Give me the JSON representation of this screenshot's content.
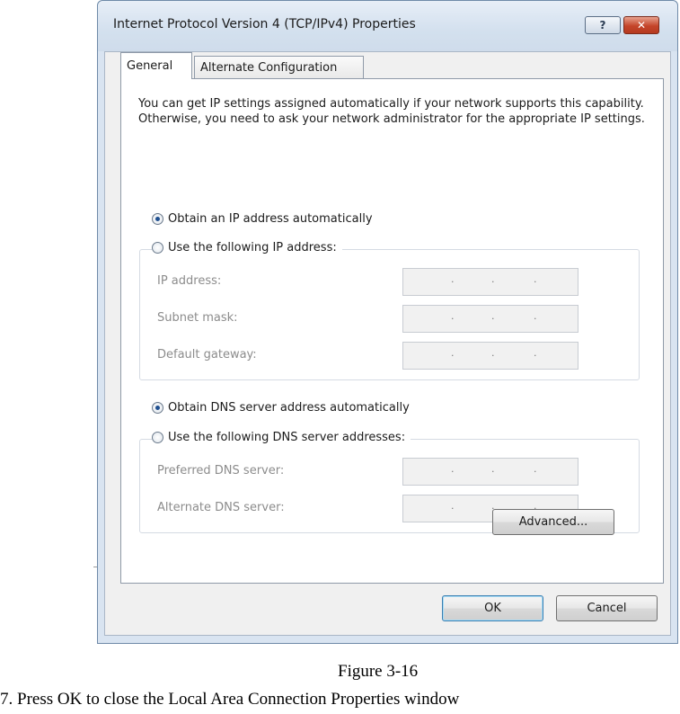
{
  "window": {
    "title": "Internet Protocol Version 4 (TCP/IPv4) Properties",
    "help_label": "?",
    "close_label": "✕"
  },
  "tabs": [
    {
      "label": "General",
      "selected": true
    },
    {
      "label": "Alternate Configuration",
      "selected": false
    }
  ],
  "general": {
    "intro": "You can get IP settings assigned automatically if your network supports this capability. Otherwise, you need to ask your network administrator for the appropriate IP settings.",
    "ip_auto": {
      "label": "Obtain an IP address automatically",
      "checked": true
    },
    "ip_manual": {
      "label": "Use the following IP address:",
      "checked": false
    },
    "ip_fields": [
      {
        "label": "IP address:",
        "value": "   .   .   ."
      },
      {
        "label": "Subnet mask:",
        "value": "   .   .   ."
      },
      {
        "label": "Default gateway:",
        "value": "   .   .   ."
      }
    ],
    "dns_auto": {
      "label": "Obtain DNS server address automatically",
      "checked": true
    },
    "dns_manual": {
      "label": "Use the following DNS server addresses:",
      "checked": false
    },
    "dns_fields": [
      {
        "label": "Preferred DNS server:",
        "value": "   .   .   ."
      },
      {
        "label": "Alternate DNS server:",
        "value": "   .   .   ."
      }
    ],
    "advanced_label": "Advanced..."
  },
  "footer": {
    "ok_label": "OK",
    "cancel_label": "Cancel"
  },
  "document": {
    "caption": "Figure 3-16",
    "step": "7. Press OK to close the Local Area Connection Properties window"
  }
}
